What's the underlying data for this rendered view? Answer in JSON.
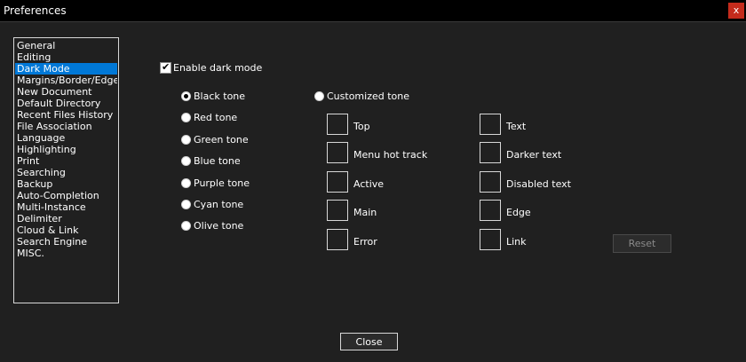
{
  "window": {
    "title": "Preferences",
    "close_glyph": "x"
  },
  "nav": {
    "items": [
      "General",
      "Editing",
      "Dark Mode",
      "Margins/Border/Edge",
      "New Document",
      "Default Directory",
      "Recent Files History",
      "File Association",
      "Language",
      "Highlighting",
      "Print",
      "Searching",
      "Backup",
      "Auto-Completion",
      "Multi-Instance",
      "Delimiter",
      "Cloud & Link",
      "Search Engine",
      "MISC."
    ],
    "selected": "Dark Mode"
  },
  "dark_mode": {
    "enable_label": "Enable dark mode",
    "enabled": true,
    "tones": [
      "Black tone",
      "Red tone",
      "Green tone",
      "Blue tone",
      "Purple tone",
      "Cyan tone",
      "Olive tone"
    ],
    "selected_tone": "Black tone",
    "customized_label": "Customized tone",
    "custom_left": [
      "Top",
      "Menu hot track",
      "Active",
      "Main",
      "Error"
    ],
    "custom_right": [
      "Text",
      "Darker text",
      "Disabled text",
      "Edge",
      "Link"
    ],
    "reset_label": "Reset"
  },
  "footer": {
    "close_label": "Close"
  },
  "colors": {
    "accent": "#0078d7",
    "background": "#202020",
    "titlebar": "#000000",
    "close_red": "#c42b1c"
  }
}
